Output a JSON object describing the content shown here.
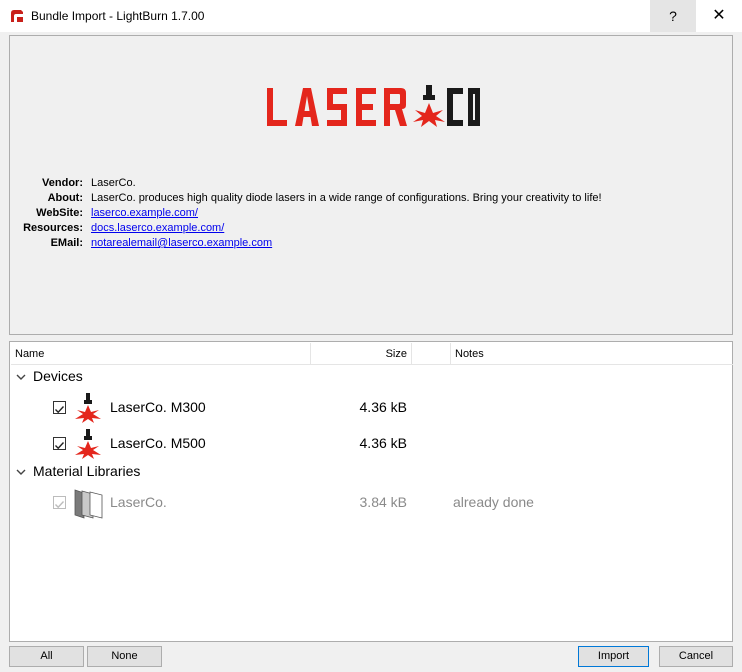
{
  "window": {
    "title": "Bundle Import - LightBurn 1.7.00",
    "help_label": "?",
    "close_label": "✕"
  },
  "vendor_info": {
    "logo_text": "LASER CO",
    "rows": [
      {
        "label": "Vendor:",
        "value": "LaserCo.",
        "is_link": false
      },
      {
        "label": "About:",
        "value": "LaserCo. produces high quality diode lasers in a wide range of configurations.  Bring your creativity to life!",
        "is_link": false
      },
      {
        "label": "WebSite:",
        "value": "laserco.example.com/",
        "is_link": true
      },
      {
        "label": "Resources:",
        "value": "docs.laserco.example.com/",
        "is_link": true
      },
      {
        "label": "EMail:",
        "value": "notarealemail@laserco.example.com",
        "is_link": true
      }
    ]
  },
  "tree": {
    "columns": {
      "name": "Name",
      "size": "Size",
      "notes": "Notes"
    },
    "groups": [
      {
        "label": "Devices",
        "expanded": true,
        "items": [
          {
            "label": "LaserCo.  M300",
            "size": "4.36 kB",
            "notes": "",
            "checked": true,
            "enabled": true,
            "icon": "laser-head-icon"
          },
          {
            "label": "LaserCo.  M500",
            "size": "4.36 kB",
            "notes": "",
            "checked": true,
            "enabled": true,
            "icon": "laser-head-icon"
          }
        ]
      },
      {
        "label": "Material Libraries",
        "expanded": true,
        "items": [
          {
            "label": "LaserCo.",
            "size": "3.84 kB",
            "notes": "already done",
            "checked": true,
            "enabled": false,
            "icon": "material-library-icon"
          }
        ]
      }
    ]
  },
  "buttons": {
    "all": "All",
    "none": "None",
    "import": "Import",
    "cancel": "Cancel"
  },
  "colors": {
    "brand_red": "#e4261c",
    "brand_dark": "#1a1a1a",
    "link": "#0000ee",
    "disabled_text": "#8a8a8a",
    "default_button_border": "#0078d7"
  }
}
